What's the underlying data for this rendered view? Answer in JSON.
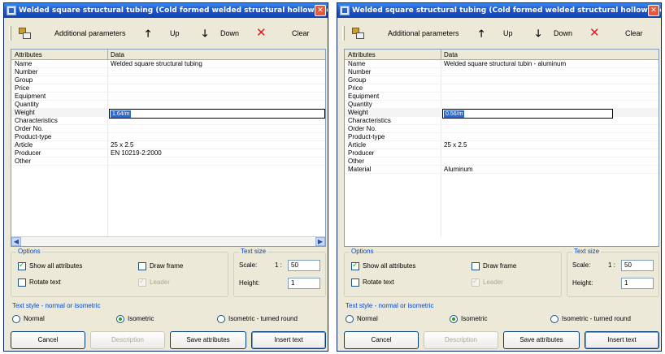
{
  "windows": [
    {
      "title": "Welded square structural tubing (Cold formed welded structural hollow sect...",
      "toolbar": {
        "additional_params": "Additional parameters",
        "up": "Up",
        "down": "Down",
        "clear": "Clear"
      },
      "grid": {
        "col_attributes": "Attributes",
        "col_data": "Data",
        "rows": [
          {
            "attr": "Name",
            "value": "Welded square structural tubing"
          },
          {
            "attr": "Number",
            "value": ""
          },
          {
            "attr": "Group",
            "value": ""
          },
          {
            "attr": "Price",
            "value": ""
          },
          {
            "attr": "Equipment",
            "value": ""
          },
          {
            "attr": "Quantity",
            "value": ""
          },
          {
            "attr": "Weight",
            "value": "1.64/m"
          },
          {
            "attr": "Characteristics",
            "value": ""
          },
          {
            "attr": "Order No.",
            "value": ""
          },
          {
            "attr": "Product-type",
            "value": ""
          },
          {
            "attr": "Article",
            "value": "25 x 2.5"
          },
          {
            "attr": "Producer",
            "value": "EN 10219-2:2000"
          },
          {
            "attr": "Other",
            "value": ""
          }
        ]
      },
      "options": {
        "title": "Options",
        "show_all_attributes": "Show all attributes",
        "draw_frame": "Draw frame",
        "rotate_text": "Rotate text",
        "leader": "Leader"
      },
      "text_size": {
        "title": "Text size",
        "scale_label": "Scale:",
        "scale_prefix": "1 :",
        "scale_value": "50",
        "height_label": "Height:",
        "height_value": "1"
      },
      "text_style": {
        "title": "Text style - normal or isometric",
        "normal": "Normal",
        "isometric": "Isometric",
        "isometric_turned": "Isometric - turned round"
      },
      "buttons": {
        "cancel": "Cancel",
        "description": "Description",
        "save_attributes": "Save attributes",
        "insert_text": "Insert text"
      }
    },
    {
      "title": "Welded square structural tubing (Cold formed welded structural hollow sect...",
      "toolbar": {
        "additional_params": "Additional parameters",
        "up": "Up",
        "down": "Down",
        "clear": "Clear"
      },
      "grid": {
        "col_attributes": "Attributes",
        "col_data": "Data",
        "rows": [
          {
            "attr": "Name",
            "value": "Welded square structural tubin - aluminum"
          },
          {
            "attr": "Number",
            "value": ""
          },
          {
            "attr": "Group",
            "value": ""
          },
          {
            "attr": "Price",
            "value": ""
          },
          {
            "attr": "Equipment",
            "value": ""
          },
          {
            "attr": "Quantity",
            "value": ""
          },
          {
            "attr": "Weight",
            "value": "0.56/m"
          },
          {
            "attr": "Characteristics",
            "value": ""
          },
          {
            "attr": "Order No.",
            "value": ""
          },
          {
            "attr": "Product-type",
            "value": ""
          },
          {
            "attr": "Article",
            "value": "25 x 2.5"
          },
          {
            "attr": "Producer",
            "value": ""
          },
          {
            "attr": "Other",
            "value": ""
          },
          {
            "attr": "Material",
            "value": "Aluminum"
          }
        ]
      },
      "options": {
        "title": "Options",
        "show_all_attributes": "Show all attributes",
        "draw_frame": "Draw frame",
        "rotate_text": "Rotate text",
        "leader": "Leader"
      },
      "text_size": {
        "title": "Text size",
        "scale_label": "Scale:",
        "scale_prefix": "1 :",
        "scale_value": "50",
        "height_label": "Height:",
        "height_value": "1"
      },
      "text_style": {
        "title": "Text style - normal or isometric",
        "normal": "Normal",
        "isometric": "Isometric",
        "isometric_turned": "Isometric - turned round"
      },
      "buttons": {
        "cancel": "Cancel",
        "description": "Description",
        "save_attributes": "Save attributes",
        "insert_text": "Insert text"
      }
    }
  ],
  "state": {
    "selected_row": "Weight",
    "show_all_attributes_checked": true,
    "draw_frame_checked": false,
    "rotate_text_checked": false,
    "leader_checked": true,
    "leader_enabled": false,
    "text_style_selected": "isometric",
    "description_enabled": false
  },
  "colors": {
    "title_bar": "#1f5ad1",
    "selection": "#316ac5",
    "group_title": "#0046d5",
    "close_button": "#e35b3c"
  }
}
